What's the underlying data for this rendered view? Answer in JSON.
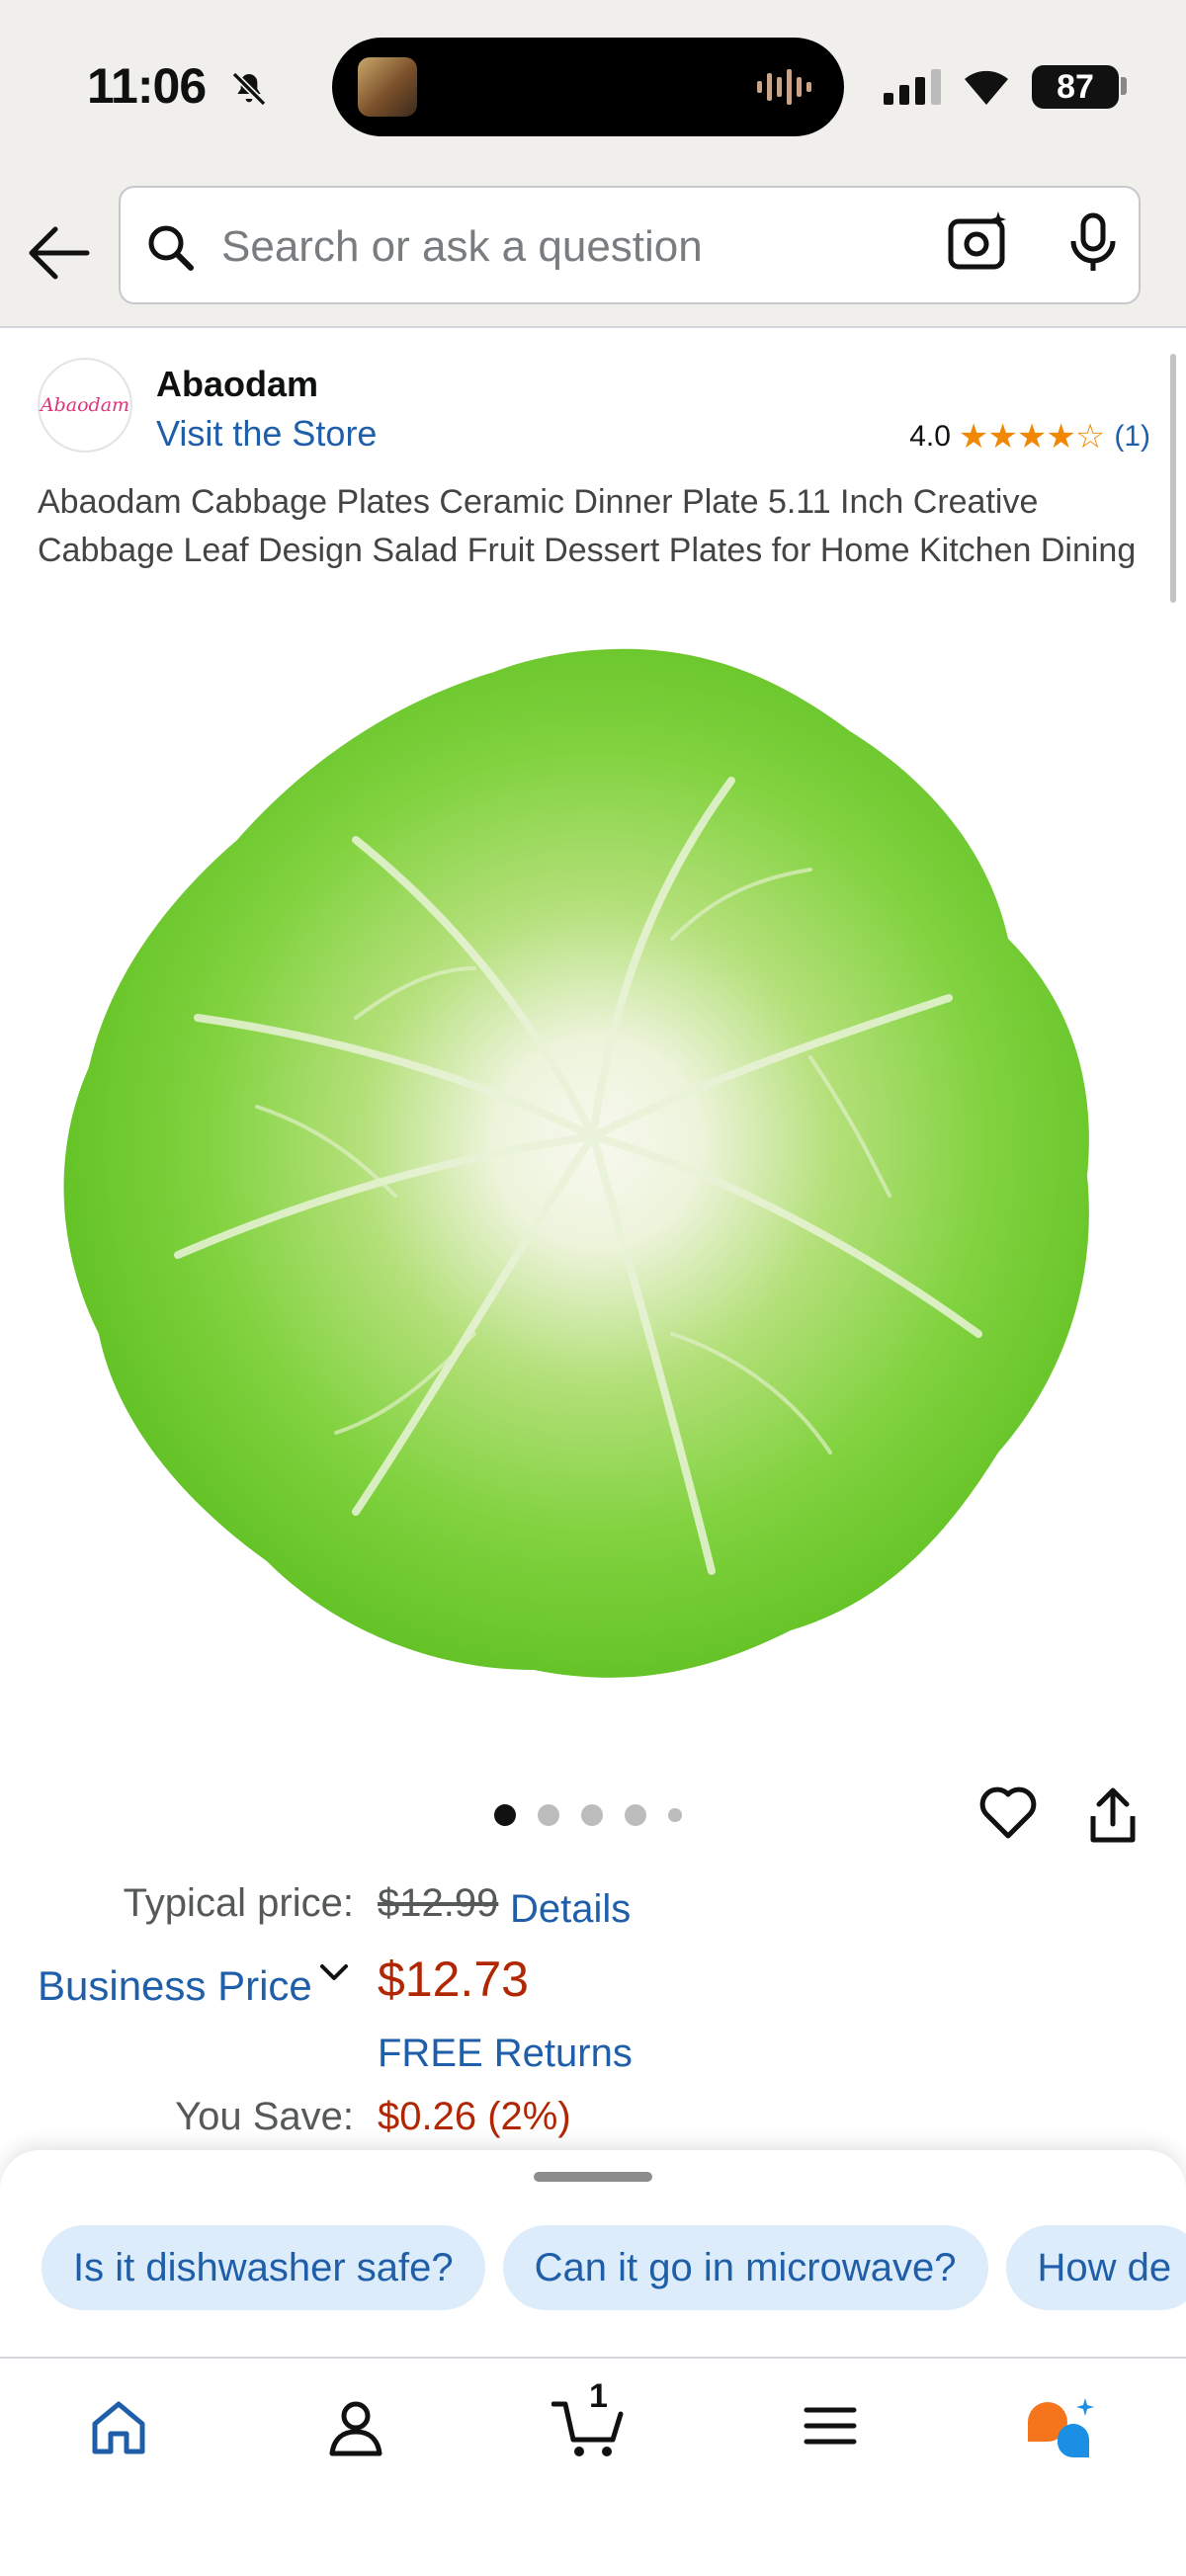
{
  "status_bar": {
    "time": "11:06",
    "battery": "87"
  },
  "search": {
    "placeholder": "Search or ask a question"
  },
  "seller": {
    "logo_text": "Abaodam",
    "name": "Abaodam",
    "store_link": "Visit the Store"
  },
  "rating": {
    "value": "4.0",
    "stars_filled": 4,
    "stars_total": 5,
    "count": "(1)",
    "star_color": "#f08804"
  },
  "product": {
    "title": "Abaodam Cabbage Plates Ceramic Dinner Plate 5.11 Inch Creative Cabbage Leaf Design Salad Fruit Dessert Plates for Home Kitchen Dining",
    "image_count": 5,
    "active_image": 1
  },
  "pricing": {
    "typical_label": "Typical price:",
    "typical_price": "$12.99",
    "details_link": "Details",
    "business_price_label": "Business Price",
    "price": "$12.73",
    "free_returns": "FREE Returns",
    "you_save_label": "You Save:",
    "you_save_value": "$0.26 (2%)",
    "price_color": "#b12704",
    "link_color": "#1f5ea8"
  },
  "suggestions": [
    "Is it dishwasher safe?",
    "Can it go in microwave?",
    "How de"
  ],
  "tabbar": {
    "items": [
      "home-icon",
      "account-icon",
      "cart-icon",
      "menu-icon",
      "rufus-icon"
    ],
    "cart_count": "1",
    "active": "home"
  }
}
